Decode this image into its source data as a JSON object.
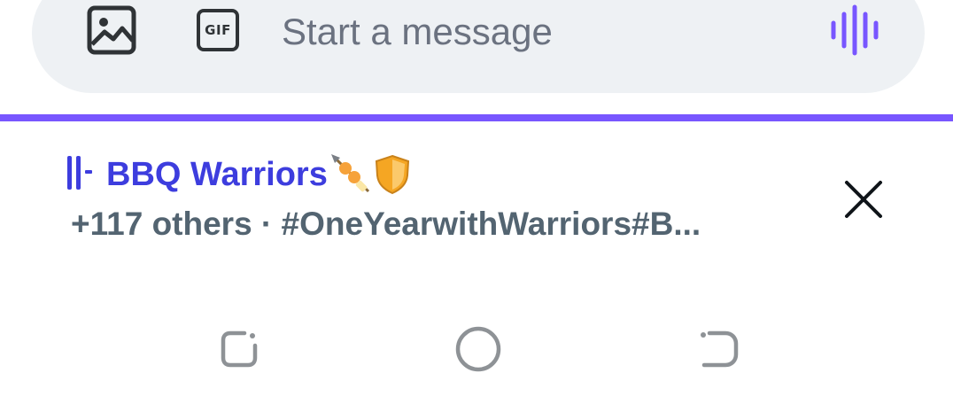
{
  "composer": {
    "placeholder": "Start a message",
    "gif_label": "GIF",
    "icons": {
      "image": "image-icon",
      "gif": "gif-icon",
      "voice": "voice-waveform-icon"
    },
    "accent_color": "#7856ff"
  },
  "space": {
    "title": "BBQ Warriors",
    "title_emoji": "🍢🛡️",
    "subtitle": "+117 others · #OneYearwithWarriors#B...",
    "title_color": "#3d3dde",
    "live_icon": "live-space-icon",
    "close_icon": "close-icon"
  },
  "navbar": {
    "icons": [
      "recents-icon",
      "home-icon",
      "back-icon"
    ]
  }
}
